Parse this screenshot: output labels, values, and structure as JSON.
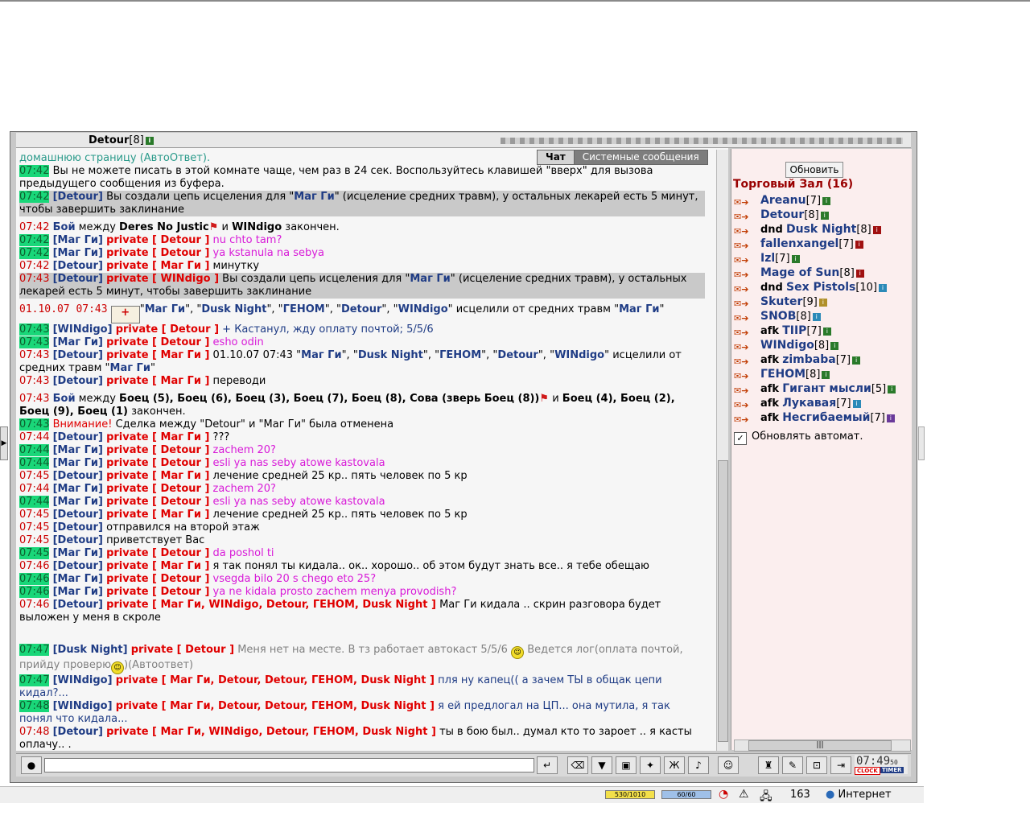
{
  "header": {
    "user": "Detour",
    "level": "[8]"
  },
  "tabs": {
    "chat": "Чат",
    "system": "Системные сообщения"
  },
  "chat": {
    "l1": "домашнюю страницу (АвтоОтвет).",
    "l2_ts": "07:42",
    "l2_text": "Вы не можете писать в этой комнате чаще, чем раз в 24 сек. Воспользуйтесь клавишей \"вверх\" для вызова предыдущего сообщения из буфера.",
    "l3_ts": "07:42",
    "l3_nick": "[Detour]",
    "l3_a": "Вы создали цепь исцеления для \"",
    "l3_name": "Маг Ги",
    "l3_b": "\" (исцеление средних травм), у остальных лекарей есть 5 минут, чтобы завершить заклинание",
    "l4_ts": "07:42",
    "l4_a": "Бой",
    "l4_b": "между",
    "l4_c": "Deres No Justic",
    "l4_d": "и",
    "l4_e": "WINdigo",
    "l4_f": "закончен.",
    "l5_ts": "07:42",
    "l5_nick": "[Маг Ги]",
    "l5_priv": "private [ Detour ]",
    "l5_text": "nu chto tam?",
    "l6_ts": "07:42",
    "l6_nick": "[Маг Ги]",
    "l6_priv": "private [ Detour ]",
    "l6_text": "ya kstanula na sebya",
    "l7_ts": "07:42",
    "l7_nick": "[Detour]",
    "l7_priv": "private [ Маг Ги ]",
    "l7_text": "минутку",
    "l8_ts": "07:43",
    "l8_nick": "[Detour]",
    "l8_priv": "private [ WINdigo ]",
    "l8_a": "Вы создали цепь исцеления для \"",
    "l8_name": "Маг Ги",
    "l8_b": "\" (исцеление средних травм), у остальных лекарей есть 5 минут, чтобы завершить заклинание",
    "l9_ts": "01.10.07 07:43",
    "l9_a": "\"",
    "l9_n1": "Маг Ги",
    "l9_s1": "\", \"",
    "l9_n2": "Dusk Night",
    "l9_s2": "\", \"",
    "l9_n3": "ГЕНОМ",
    "l9_s3": "\", \"",
    "l9_n4": "Detour",
    "l9_s4": "\", \"",
    "l9_n5": "WINdigo",
    "l9_b": "\" исцелили от средних травм \"",
    "l9_n6": "Маг Ги",
    "l9_c": "\"",
    "l10_ts": "07:43",
    "l10_nick": "[WINdigo]",
    "l10_priv": "private [ Detour ]",
    "l10_text": "+ Кастанул, жду оплату почтой; 5/5/6",
    "l11_ts": "07:43",
    "l11_nick": "[Маг Ги]",
    "l11_priv": "private [ Detour ]",
    "l11_text": "esho odin",
    "l12_ts": "07:43",
    "l12_nick": "[Detour]",
    "l12_priv": "private [ Маг Ги ]",
    "l12_a": "01.10.07 07:43 \"",
    "l12_n1": "Маг Ги",
    "l12_s1": "\", \"",
    "l12_n2": "Dusk Night",
    "l12_s2": "\", \"",
    "l12_n3": "ГЕНОМ",
    "l12_s3": "\", \"",
    "l12_n4": "Detour",
    "l12_s4": "\", \"",
    "l12_n5": "WINdigo",
    "l12_b": "\" исцелили от средних травм \"",
    "l12_n6": "Маг Ги",
    "l12_c": "\"",
    "l13_ts": "07:43",
    "l13_nick": "[Detour]",
    "l13_priv": "private [ Маг Ги ]",
    "l13_text": "переводи",
    "l14_ts": "07:43",
    "l14_a": "Бой",
    "l14_b": "между",
    "l14_c": "Боец (5), Боец (6), Боец (3), Боец (7), Боец (8), Сова (зверь Боец (8))",
    "l14_d": "и",
    "l14_e": "Боец (4), Боец (2), Боец (9), Боец (1)",
    "l14_f": "закончен.",
    "l15_ts": "07:43",
    "l15_warn": "Внимание!",
    "l15_text": "Сделка между \"Detour\" и \"Маг Ги\" была отменена",
    "l16_ts": "07:44",
    "l16_nick": "[Detour]",
    "l16_priv": "private [ Маг Ги ]",
    "l16_text": "???",
    "l17_ts": "07:44",
    "l17_nick": "[Маг Ги]",
    "l17_priv": "private [ Detour ]",
    "l17_text": "zachem 20?",
    "l18_ts": "07:44",
    "l18_nick": "[Маг Ги]",
    "l18_priv": "private [ Detour ]",
    "l18_text": "esli ya nas seby atowe kastovala",
    "l19_ts": "07:45",
    "l19_nick": "[Detour]",
    "l19_priv": "private [ Маг Ги ]",
    "l19_text": "лечение средней 25 кр.. пять человек по 5 кр",
    "l20_ts": "07:44",
    "l20_nick": "[Маг Ги]",
    "l20_priv": "private [ Detour ]",
    "l20_text": "zachem 20?",
    "l21_ts": "07:44",
    "l21_nick": "[Маг Ги]",
    "l21_priv": "private [ Detour ]",
    "l21_text": "esli ya nas seby atowe kastovala",
    "l22_ts": "07:45",
    "l22_nick": "[Detour]",
    "l22_priv": "private [ Маг Ги ]",
    "l22_text": "лечение средней 25 кр.. пять человек по 5 кр",
    "l23_ts": "07:45",
    "l23_nick": "[Detour]",
    "l23_text": "отправился на второй этаж",
    "l24_ts": "07:45",
    "l24_nick": "[Detour]",
    "l24_text": "приветствует Вас",
    "l25_ts": "07:45",
    "l25_nick": "[Маг Ги]",
    "l25_priv": "private [ Detour ]",
    "l25_text": "da poshol ti",
    "l26_ts": "07:46",
    "l26_nick": "[Detour]",
    "l26_priv": "private [ Маг Ги ]",
    "l26_text": "я так понял ты кидала.. ок.. хорошо.. об этом будут знать все.. я тебе обещаю",
    "l27_ts": "07:46",
    "l27_nick": "[Маг Ги]",
    "l27_priv": "private [ Detour ]",
    "l27_text": "vsegda bilo 20 s chego eto 25?",
    "l28_ts": "07:46",
    "l28_nick": "[Маг Ги]",
    "l28_priv": "private [ Detour ]",
    "l28_text": "ya ne kidala prosto zachem menya provodish?",
    "l29_ts": "07:46",
    "l29_nick": "[Detour]",
    "l29_priv": "private [ Маг Ги, WINdigo, Detour, ГЕНОМ, Dusk Night ]",
    "l29_text": "Маг Ги кидала .. скрин разговора будет выложен у меня в скроле",
    "l30_ts": "07:47",
    "l30_nick": "[Dusk Night]",
    "l30_priv": "private [ Detour ]",
    "l30_a": "Меня нет на месте. В тз работает автокаст 5/5/6",
    "l30_b": "Ведется лог(оплата почтой, прийду проверю",
    "l30_c": ")(Автоответ)",
    "l31_ts": "07:47",
    "l31_nick": "[WINdigo]",
    "l31_priv": "private [ Маг Ги, Detour, Detour, ГЕНОМ, Dusk Night ]",
    "l31_text": "пля ну капец(( а зачем ТЫ в общак цепи кидал?...",
    "l32_ts": "07:48",
    "l32_nick": "[WINdigo]",
    "l32_priv": "private [ Маг Ги, Detour, Detour, ГЕНОМ, Dusk Night ]",
    "l32_text": "я ей предлогал на ЦП... она мутила, я так понял что кидала...",
    "l33_ts": "07:48",
    "l33_nick": "[Detour]",
    "l33_priv": "private [ Маг Ги, WINdigo, Detour, ГЕНОМ, Dusk Night ]",
    "l33_text": "ты в бою был.. думал кто то зароет .. я касты оплачу.. ."
  },
  "sidebar": {
    "refresh": "Обновить",
    "room": "Торговый Зал (16)",
    "users": [
      {
        "prefix": "",
        "name": "Areanu",
        "level": "[7]"
      },
      {
        "prefix": "",
        "name": "Detour",
        "level": "[8]"
      },
      {
        "prefix": "dnd",
        "name": "Dusk Night",
        "level": "[8]"
      },
      {
        "prefix": "",
        "name": "fallenxangel",
        "level": "[7]"
      },
      {
        "prefix": "",
        "name": "Izl",
        "level": "[7]"
      },
      {
        "prefix": "",
        "name": "Mage of Sun",
        "level": "[8]"
      },
      {
        "prefix": "dnd",
        "name": "Sex Pistols",
        "level": "[10]"
      },
      {
        "prefix": "",
        "name": "Skuter",
        "level": "[9]"
      },
      {
        "prefix": "",
        "name": "SNOB",
        "level": "[8]"
      },
      {
        "prefix": "afk",
        "name": "TIIP",
        "level": "[7]"
      },
      {
        "prefix": "",
        "name": "WINdigo",
        "level": "[8]"
      },
      {
        "prefix": "afk",
        "name": "zimbaba",
        "level": "[7]"
      },
      {
        "prefix": "",
        "name": "ГЕНОМ",
        "level": "[8]"
      },
      {
        "prefix": "afk",
        "name": "Гигант мысли",
        "level": "[5]"
      },
      {
        "prefix": "afk",
        "name": "Лукавая",
        "level": "[7]"
      },
      {
        "prefix": "afk",
        "name": "Несгибаемый",
        "level": "[7]"
      }
    ],
    "auto_refresh": "Обновлять автомат."
  },
  "clock": {
    "time": "07:49",
    "sec": "50",
    "clock_label": "CLOCK",
    "timer_label": "TIMER"
  },
  "status": {
    "hp": "530/1010",
    "mp": "60/60",
    "count": "163",
    "zone": "Интернет"
  }
}
